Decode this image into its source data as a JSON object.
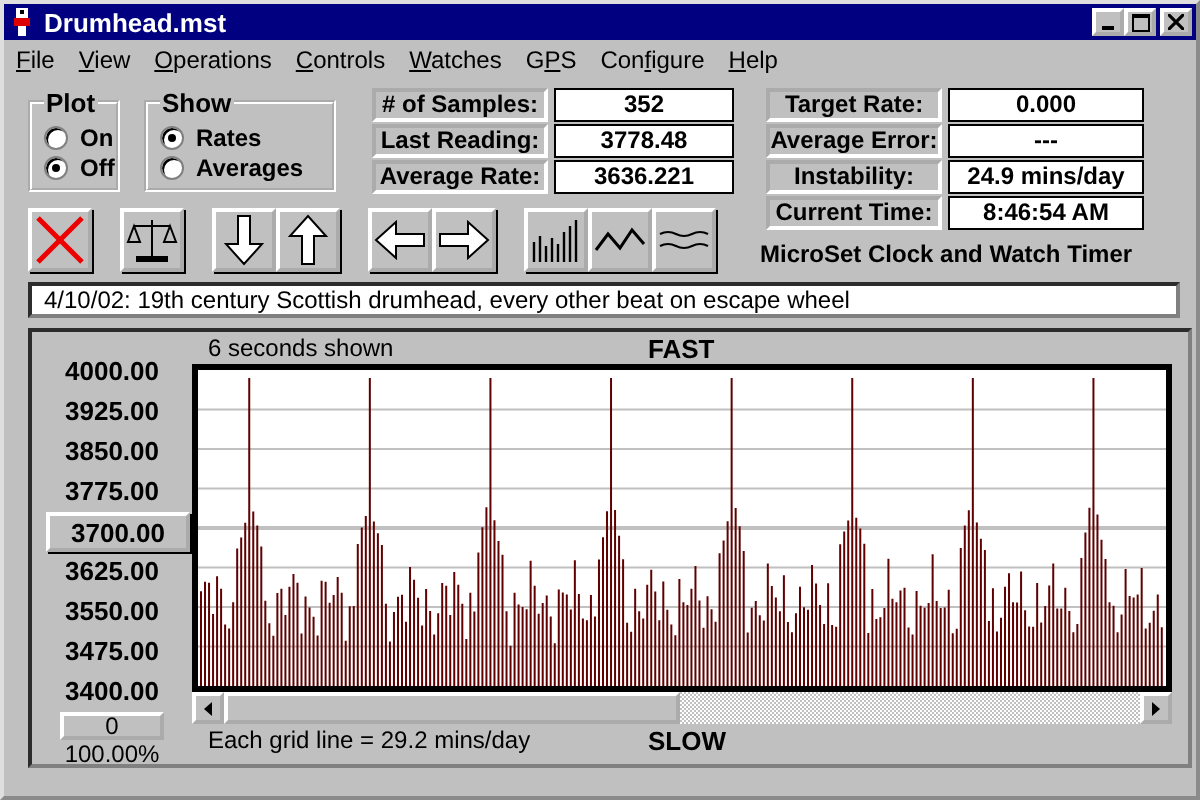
{
  "window": {
    "title": "Drumhead.mst"
  },
  "menu": [
    {
      "mnemonic": "F",
      "after": "ile"
    },
    {
      "mnemonic": "V",
      "after": "iew"
    },
    {
      "mnemonic": "O",
      "after": "perations"
    },
    {
      "mnemonic": "C",
      "after": "ontrols"
    },
    {
      "mnemonic": "W",
      "after": "atches"
    },
    {
      "before": "G",
      "mnemonic": "P",
      "after": "S"
    },
    {
      "before": "Con",
      "mnemonic": "f",
      "after": "igure"
    },
    {
      "mnemonic": "H",
      "after": "elp"
    }
  ],
  "plot_group": {
    "title": "Plot",
    "options": [
      {
        "label": "On",
        "selected": false
      },
      {
        "label": "Off",
        "selected": true
      }
    ]
  },
  "show_group": {
    "title": "Show",
    "options": [
      {
        "label": "Rates",
        "selected": true
      },
      {
        "label": "Averages",
        "selected": false
      }
    ]
  },
  "stats_left": [
    {
      "label": "# of Samples:",
      "value": "352"
    },
    {
      "label": "Last Reading:",
      "value": "3778.48"
    },
    {
      "label": "Average Rate:",
      "value": "3636.221"
    }
  ],
  "stats_right": [
    {
      "label": "Target Rate:",
      "value": "0.000"
    },
    {
      "label": "Average Error:",
      "value": "---"
    },
    {
      "label": "Instability:",
      "value": "24.9 mins/day"
    },
    {
      "label": "Current Time:",
      "value": "8:46:54 AM"
    }
  ],
  "app_name": "MicroSet Clock and Watch Timer",
  "notes": {
    "value": "4/10/02: 19th century Scottish drumhead, every other beat on escape wheel"
  },
  "chart": {
    "seconds_shown": "6 seconds shown",
    "top_label": "FAST",
    "bottom_label": "SLOW",
    "grid_note": "Each grid line = 29.2 mins/day",
    "y_labels": [
      {
        "text": "4000.00",
        "kind": "label"
      },
      {
        "text": "3925.00",
        "kind": "label"
      },
      {
        "text": "3850.00",
        "kind": "label"
      },
      {
        "text": "3775.00",
        "kind": "label"
      },
      {
        "text": "3700.00",
        "kind": "button"
      },
      {
        "text": "3625.00",
        "kind": "label"
      },
      {
        "text": "3550.00",
        "kind": "label"
      },
      {
        "text": "3475.00",
        "kind": "label"
      },
      {
        "text": "3400.00",
        "kind": "label"
      }
    ],
    "offset_button": "0",
    "zoom": "100.00%"
  }
}
